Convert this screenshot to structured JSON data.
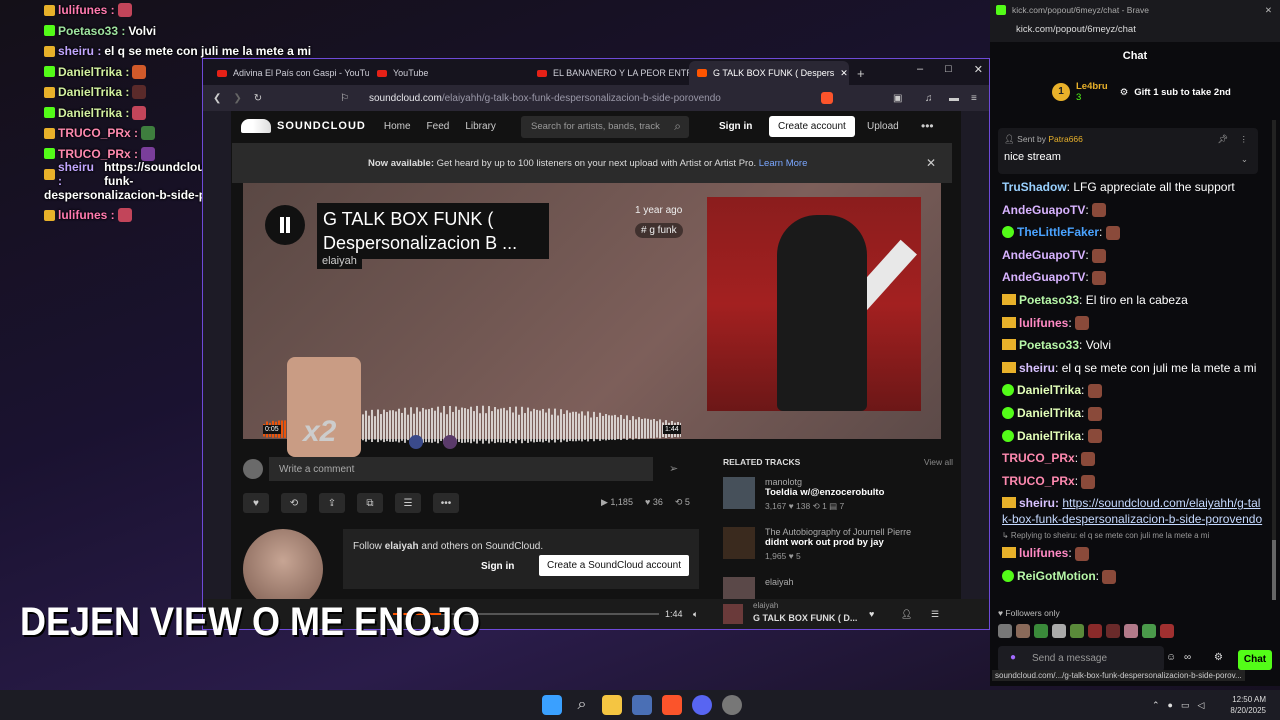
{
  "overlay_chat": [
    {
      "user": "lulifunes",
      "color": "#ff7ab0",
      "msg": ""
    },
    {
      "user": "Poetaso33",
      "color": "#9fe3a0",
      "msg": "Volvi"
    },
    {
      "user": "sheiru",
      "color": "#c2a6ff",
      "msg": "el q se mete con juli me la mete a mi"
    },
    {
      "user": "DanielTrika",
      "color": "#d2f0a0",
      "msg": ""
    },
    {
      "user": "DanielTrika",
      "color": "#d2f0a0",
      "msg": ""
    },
    {
      "user": "DanielTrika",
      "color": "#d2f0a0",
      "msg": ""
    },
    {
      "user": "TRUCO_PRx",
      "color": "#ff8ab0",
      "msg": ""
    },
    {
      "user": "TRUCO_PRx",
      "color": "#ff8ab0",
      "msg": ""
    },
    {
      "user": "sheiru",
      "color": "#c2a6ff",
      "msg": "https://soundcloud.com/elaiyahh/g-talk-box-funk-"
    },
    {
      "user": "",
      "color": "#ffffff",
      "msg": "despersonalizacion-b-side-porovendo"
    },
    {
      "user": "lulifunes",
      "color": "#ff7ab0",
      "msg": ""
    }
  ],
  "browser": {
    "tabs": [
      "Adivina El País con Gaspi - YouTube",
      "YouTube",
      "EL BANANERO Y LA PEOR ENTREVIS",
      "G TALK BOX FUNK ( Despers"
    ],
    "new_tab": "+",
    "url_host": "soundcloud.com",
    "url_path": "/elaiyahh/g-talk-box-funk-despersonalizacion-b-side-porovendo",
    "win_min": "–",
    "win_max": "□",
    "win_close": "✕"
  },
  "soundcloud": {
    "logo": "SOUNDCLOUD",
    "nav": [
      "Home",
      "Feed",
      "Library"
    ],
    "search_placeholder": "Search for artists, bands, track",
    "signin": "Sign in",
    "create_account": "Create account",
    "upload": "Upload",
    "more": "•••",
    "banner_bold": "Now available:",
    "banner_text": "Get heard by up to 100 listeners on your next upload with Artist or Artist Pro.",
    "banner_link": "Learn More",
    "banner_close": "✕",
    "title": "G TALK BOX FUNK ( Despersonalizacion B ...",
    "artist": "elaiyah",
    "posted": "1 year ago",
    "tag": "# g funk",
    "time_current": "0:05",
    "time_total": "1:44",
    "overlay_x2": "x2",
    "comment_placeholder": "Write a comment",
    "plays": "1,185",
    "likes": "36",
    "reposts": "5",
    "related_title": "RELATED TRACKS",
    "view_all": "View all",
    "related": [
      {
        "user": "manolotg",
        "title": "Toeldia w/@enzocerobulto",
        "stats": "3,167  ♥ 138  ⟲ 1  ▤ 7"
      },
      {
        "user": "The Autobiography of Journell Pierre",
        "title": "didnt work out prod by jay",
        "stats": "1,965  ♥ 5"
      },
      {
        "user": "elaiyah",
        "title": "",
        "stats": ""
      }
    ],
    "follow_text_pre": "Follow",
    "follow_user": "elaiyah",
    "follow_text_post": "and others on SoundCloud.",
    "follow_signin": "Sign in",
    "follow_create": "Create a SoundCloud account",
    "player_time_end": "1:44",
    "player_artist": "elaiyah",
    "player_title": "G TALK BOX FUNK ( D...",
    "progress_fraction": 0.18
  },
  "overlay_bigtext": "DEJEN VIEW O ME ENOJO",
  "kick": {
    "titlebar": "kick.com/popout/6meyz/chat - Brave",
    "url": "kick.com/popout/6meyz/chat",
    "header": "Chat",
    "gifter_name": "Le4bru",
    "gifter_count": "3",
    "gifter_rank": "1",
    "gift_text": "Gift 1 sub to take 2nd",
    "pinned_by_label": "Sent by",
    "pinned_by": "Patra666",
    "pinned_text": "nice stream",
    "messages": [
      {
        "user": "TruShadow",
        "color": "#9ad1ff",
        "badge": "none",
        "text": "LFG appreciate all the support"
      },
      {
        "user": "AndeGuapoTV",
        "color": "#d8b3ff",
        "badge": "none",
        "text": ""
      },
      {
        "user": "TheLittleFaker",
        "color": "#4aa3ff",
        "badge": "verified",
        "text": ""
      },
      {
        "user": "AndeGuapoTV",
        "color": "#d8b3ff",
        "badge": "none",
        "text": ""
      },
      {
        "user": "AndeGuapoTV",
        "color": "#d8b3ff",
        "badge": "none",
        "text": ""
      },
      {
        "user": "Poetaso33",
        "color": "#b7f7a8",
        "badge": "crown",
        "text": "El tiro en la cabeza"
      },
      {
        "user": "lulifunes",
        "color": "#ff8ac4",
        "badge": "crown",
        "text": ""
      },
      {
        "user": "Poetaso33",
        "color": "#b7f7a8",
        "badge": "crown",
        "text": "Volvi"
      },
      {
        "user": "sheiru",
        "color": "#d8c2ff",
        "badge": "crown",
        "text": "el q se mete con juli me la mete a mi"
      },
      {
        "user": "DanielTrika",
        "color": "#e2ffb8",
        "badge": "verified",
        "text": ""
      },
      {
        "user": "DanielTrika",
        "color": "#e2ffb8",
        "badge": "verified",
        "text": ""
      },
      {
        "user": "DanielTrika",
        "color": "#e2ffb8",
        "badge": "verified",
        "text": ""
      },
      {
        "user": "TRUCO_PRx",
        "color": "#ff8ab0",
        "badge": "none",
        "text": ""
      },
      {
        "user": "TRUCO_PRx",
        "color": "#ff8ab0",
        "badge": "none",
        "text": ""
      }
    ],
    "link_user": "sheiru",
    "link_text": "https://soundcloud.com/elaiyahh/g-talk-box-funk-despersonalizacion-b-side-porovendo",
    "reply_text": "Replying to sheiru: el q se mete con juli me la mete a mi",
    "after_messages": [
      {
        "user": "lulifunes",
        "color": "#ff8ac4",
        "badge": "crown",
        "text": ""
      },
      {
        "user": "ReiGotMotion",
        "color": "#b7f7a8",
        "badge": "verified",
        "text": ""
      }
    ],
    "followers_only": "Followers only",
    "send_placeholder": "Send a message",
    "chat_button": "Chat",
    "status_url": "soundcloud.com/.../g-talk-box-funk-despersonalizacion-b-side-porov..."
  },
  "taskbar": {
    "time": "12:50 AM",
    "date": "8/20/2025"
  }
}
